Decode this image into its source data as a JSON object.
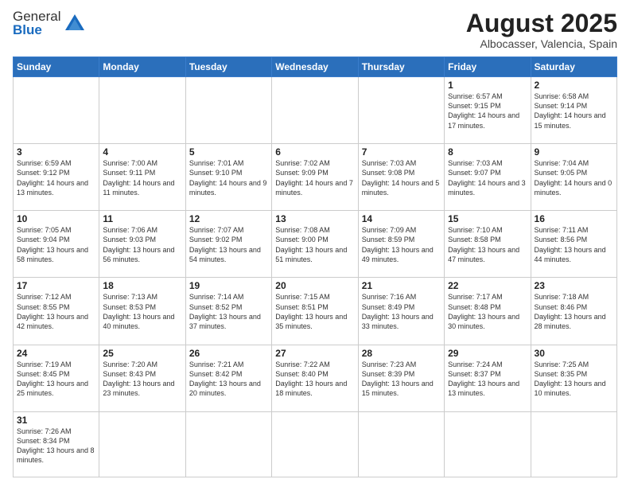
{
  "logo": {
    "text_general": "General",
    "text_blue": "Blue"
  },
  "header": {
    "month_title": "August 2025",
    "location": "Albocasser, Valencia, Spain"
  },
  "weekdays": [
    "Sunday",
    "Monday",
    "Tuesday",
    "Wednesday",
    "Thursday",
    "Friday",
    "Saturday"
  ],
  "weeks": [
    [
      {
        "day": "",
        "info": "",
        "empty": true
      },
      {
        "day": "",
        "info": "",
        "empty": true
      },
      {
        "day": "",
        "info": "",
        "empty": true
      },
      {
        "day": "",
        "info": "",
        "empty": true
      },
      {
        "day": "",
        "info": "",
        "empty": true
      },
      {
        "day": "1",
        "info": "Sunrise: 6:57 AM\nSunset: 9:15 PM\nDaylight: 14 hours\nand 17 minutes."
      },
      {
        "day": "2",
        "info": "Sunrise: 6:58 AM\nSunset: 9:14 PM\nDaylight: 14 hours\nand 15 minutes."
      }
    ],
    [
      {
        "day": "3",
        "info": "Sunrise: 6:59 AM\nSunset: 9:12 PM\nDaylight: 14 hours\nand 13 minutes."
      },
      {
        "day": "4",
        "info": "Sunrise: 7:00 AM\nSunset: 9:11 PM\nDaylight: 14 hours\nand 11 minutes."
      },
      {
        "day": "5",
        "info": "Sunrise: 7:01 AM\nSunset: 9:10 PM\nDaylight: 14 hours\nand 9 minutes."
      },
      {
        "day": "6",
        "info": "Sunrise: 7:02 AM\nSunset: 9:09 PM\nDaylight: 14 hours\nand 7 minutes."
      },
      {
        "day": "7",
        "info": "Sunrise: 7:03 AM\nSunset: 9:08 PM\nDaylight: 14 hours\nand 5 minutes."
      },
      {
        "day": "8",
        "info": "Sunrise: 7:03 AM\nSunset: 9:07 PM\nDaylight: 14 hours\nand 3 minutes."
      },
      {
        "day": "9",
        "info": "Sunrise: 7:04 AM\nSunset: 9:05 PM\nDaylight: 14 hours\nand 0 minutes."
      }
    ],
    [
      {
        "day": "10",
        "info": "Sunrise: 7:05 AM\nSunset: 9:04 PM\nDaylight: 13 hours\nand 58 minutes."
      },
      {
        "day": "11",
        "info": "Sunrise: 7:06 AM\nSunset: 9:03 PM\nDaylight: 13 hours\nand 56 minutes."
      },
      {
        "day": "12",
        "info": "Sunrise: 7:07 AM\nSunset: 9:02 PM\nDaylight: 13 hours\nand 54 minutes."
      },
      {
        "day": "13",
        "info": "Sunrise: 7:08 AM\nSunset: 9:00 PM\nDaylight: 13 hours\nand 51 minutes."
      },
      {
        "day": "14",
        "info": "Sunrise: 7:09 AM\nSunset: 8:59 PM\nDaylight: 13 hours\nand 49 minutes."
      },
      {
        "day": "15",
        "info": "Sunrise: 7:10 AM\nSunset: 8:58 PM\nDaylight: 13 hours\nand 47 minutes."
      },
      {
        "day": "16",
        "info": "Sunrise: 7:11 AM\nSunset: 8:56 PM\nDaylight: 13 hours\nand 44 minutes."
      }
    ],
    [
      {
        "day": "17",
        "info": "Sunrise: 7:12 AM\nSunset: 8:55 PM\nDaylight: 13 hours\nand 42 minutes."
      },
      {
        "day": "18",
        "info": "Sunrise: 7:13 AM\nSunset: 8:53 PM\nDaylight: 13 hours\nand 40 minutes."
      },
      {
        "day": "19",
        "info": "Sunrise: 7:14 AM\nSunset: 8:52 PM\nDaylight: 13 hours\nand 37 minutes."
      },
      {
        "day": "20",
        "info": "Sunrise: 7:15 AM\nSunset: 8:51 PM\nDaylight: 13 hours\nand 35 minutes."
      },
      {
        "day": "21",
        "info": "Sunrise: 7:16 AM\nSunset: 8:49 PM\nDaylight: 13 hours\nand 33 minutes."
      },
      {
        "day": "22",
        "info": "Sunrise: 7:17 AM\nSunset: 8:48 PM\nDaylight: 13 hours\nand 30 minutes."
      },
      {
        "day": "23",
        "info": "Sunrise: 7:18 AM\nSunset: 8:46 PM\nDaylight: 13 hours\nand 28 minutes."
      }
    ],
    [
      {
        "day": "24",
        "info": "Sunrise: 7:19 AM\nSunset: 8:45 PM\nDaylight: 13 hours\nand 25 minutes."
      },
      {
        "day": "25",
        "info": "Sunrise: 7:20 AM\nSunset: 8:43 PM\nDaylight: 13 hours\nand 23 minutes."
      },
      {
        "day": "26",
        "info": "Sunrise: 7:21 AM\nSunset: 8:42 PM\nDaylight: 13 hours\nand 20 minutes."
      },
      {
        "day": "27",
        "info": "Sunrise: 7:22 AM\nSunset: 8:40 PM\nDaylight: 13 hours\nand 18 minutes."
      },
      {
        "day": "28",
        "info": "Sunrise: 7:23 AM\nSunset: 8:39 PM\nDaylight: 13 hours\nand 15 minutes."
      },
      {
        "day": "29",
        "info": "Sunrise: 7:24 AM\nSunset: 8:37 PM\nDaylight: 13 hours\nand 13 minutes."
      },
      {
        "day": "30",
        "info": "Sunrise: 7:25 AM\nSunset: 8:35 PM\nDaylight: 13 hours\nand 10 minutes."
      }
    ],
    [
      {
        "day": "31",
        "info": "Sunrise: 7:26 AM\nSunset: 8:34 PM\nDaylight: 13 hours\nand 8 minutes."
      },
      {
        "day": "",
        "info": "",
        "empty": true
      },
      {
        "day": "",
        "info": "",
        "empty": true
      },
      {
        "day": "",
        "info": "",
        "empty": true
      },
      {
        "day": "",
        "info": "",
        "empty": true
      },
      {
        "day": "",
        "info": "",
        "empty": true
      },
      {
        "day": "",
        "info": "",
        "empty": true
      }
    ]
  ]
}
